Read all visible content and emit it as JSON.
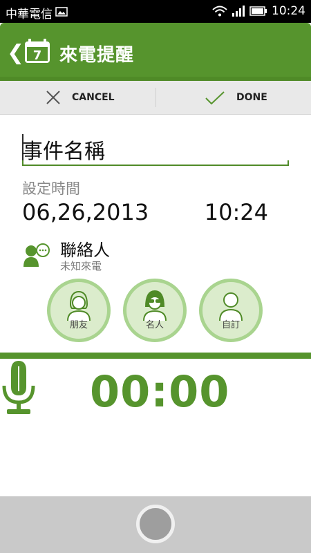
{
  "status_bar": {
    "carrier": "中華電信",
    "time": "10:24"
  },
  "header": {
    "title": "來電提醒",
    "calendar_day": "7"
  },
  "actions": {
    "cancel_label": "CANCEL",
    "done_label": "DONE"
  },
  "event": {
    "name_value": "事件名稱",
    "set_time_label": "設定時間",
    "date": "06,26,2013",
    "time": "10:24"
  },
  "contacts": {
    "label": "聯絡人",
    "subtitle": "未知來電",
    "options": [
      {
        "label": "朋友"
      },
      {
        "label": "名人"
      },
      {
        "label": "自訂"
      }
    ]
  },
  "recording": {
    "timer": "00:00"
  },
  "colors": {
    "accent": "#56942d",
    "light_green": "#dbeccc",
    "ring_green": "#a9d48f"
  }
}
